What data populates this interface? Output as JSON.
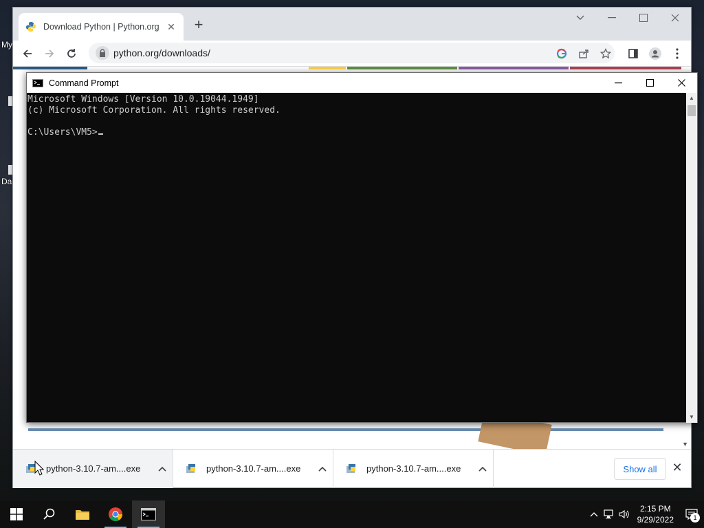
{
  "desktop": {
    "labels": [
      "My",
      "Da"
    ]
  },
  "browser": {
    "tab": {
      "title": "Download Python | Python.org",
      "favicon": "python-logo-icon",
      "close_glyph": "✕"
    },
    "new_tab_glyph": "+",
    "window_controls": {
      "dropdown_glyph": "⌄",
      "minimize_glyph": "—",
      "maximize_glyph": "☐",
      "close_glyph": "✕"
    },
    "address_bar": {
      "url": "python.org/downloads/"
    },
    "page": {
      "heading_fragment": "..."
    },
    "downloads_bar": {
      "items": [
        {
          "name": "python-3.10.7-am....exe"
        },
        {
          "name": "python-3.10.7-am....exe"
        },
        {
          "name": "python-3.10.7-am....exe"
        }
      ],
      "show_all_label": "Show all",
      "close_glyph": "✕"
    }
  },
  "cmd": {
    "title": "Command Prompt",
    "lines": [
      "Microsoft Windows [Version 10.0.19044.1949]",
      "(c) Microsoft Corporation. All rights reserved.",
      "",
      "C:\\Users\\VM5>"
    ]
  },
  "taskbar": {
    "apps": [
      {
        "name": "start-button"
      },
      {
        "name": "search"
      },
      {
        "name": "file-explorer"
      },
      {
        "name": "chrome"
      },
      {
        "name": "command-prompt"
      }
    ],
    "clock": {
      "time": "2:15 PM",
      "date": "9/29/2022"
    },
    "notification_count": "1"
  },
  "colors": {
    "chrome_accent": "#1a73e8",
    "cmd_background": "#0c0c0c",
    "cmd_text": "#cccccc",
    "taskbar": "#101010"
  }
}
